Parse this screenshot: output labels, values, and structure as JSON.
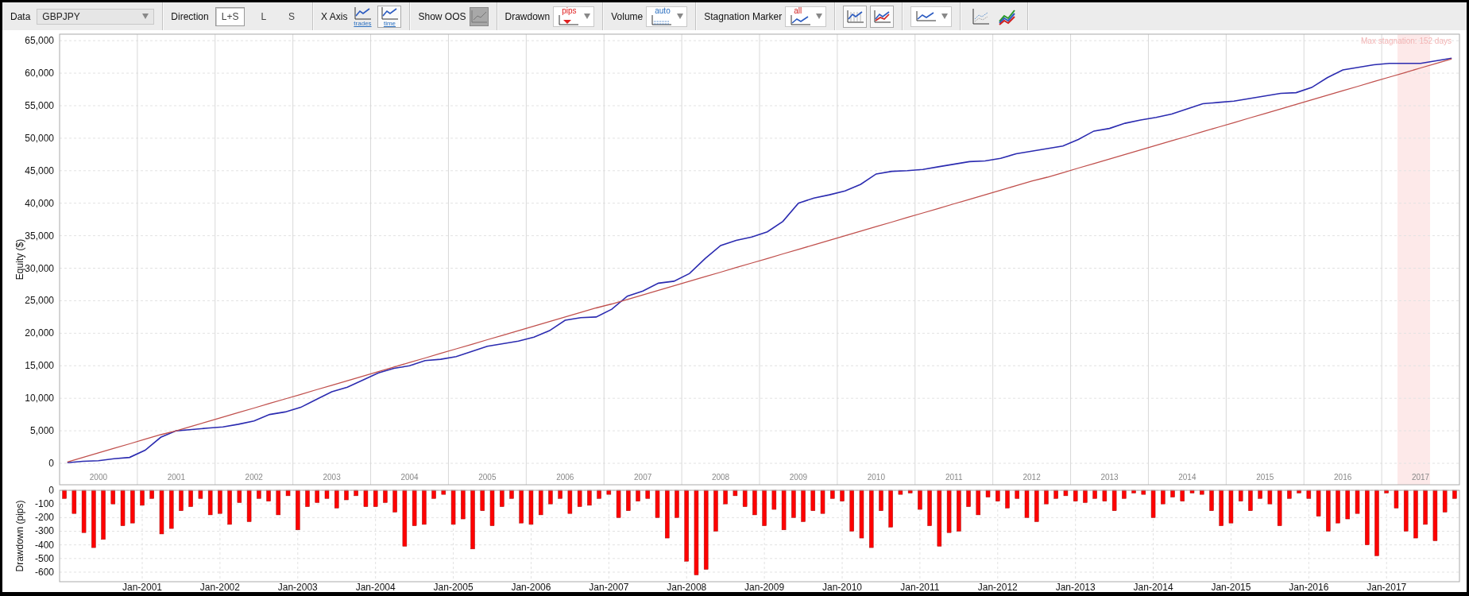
{
  "toolbar": [
    {
      "kind": "dropdown",
      "label": "Data",
      "value": "GBPJPY"
    },
    {
      "kind": "segmented",
      "label": "Direction",
      "options": [
        {
          "text": "L+S",
          "selected": true
        },
        {
          "text": "L",
          "selected": false
        },
        {
          "text": "S",
          "selected": false
        }
      ]
    },
    {
      "kind": "icons",
      "label": "X Axis",
      "buttons": [
        {
          "caption": "trades",
          "selected": false
        },
        {
          "caption": "time",
          "selected": true
        }
      ]
    },
    {
      "kind": "toggle",
      "label": "Show OOS",
      "disabled": true
    },
    {
      "kind": "icon-dropdown",
      "label": "Drawdown",
      "caption": "pips"
    },
    {
      "kind": "icon-dropdown",
      "label": "Volume",
      "caption": "auto"
    },
    {
      "kind": "icon-dropdown",
      "label": "Stagnation Marker",
      "caption": "all"
    },
    {
      "kind": "icons",
      "buttons": [
        {
          "selected": true
        },
        {
          "selected": true
        }
      ]
    },
    {
      "kind": "icon-dropdown"
    },
    {
      "kind": "icons",
      "buttons": [
        {
          "selected": false
        },
        {
          "selected": false
        }
      ]
    }
  ],
  "equity_chart": {
    "chart_data": {
      "type": "line",
      "ylabel": "Equity ($)",
      "categories": [
        null,
        null,
        "2000",
        null,
        null,
        null,
        null,
        "2001",
        null,
        null,
        null,
        null,
        "2002",
        null,
        null,
        null,
        null,
        "2003",
        null,
        null,
        null,
        null,
        "2004",
        null,
        null,
        null,
        null,
        "2005",
        null,
        null,
        null,
        null,
        "2006",
        null,
        null,
        null,
        null,
        "2007",
        null,
        null,
        null,
        null,
        "2008",
        null,
        null,
        null,
        null,
        "2009",
        null,
        null,
        null,
        null,
        "2010",
        null,
        null,
        null,
        null,
        "2011",
        null,
        null,
        null,
        null,
        "2012",
        null,
        null,
        null,
        null,
        "2013",
        null,
        null,
        null,
        null,
        "2014",
        null,
        null,
        null,
        null,
        "2015",
        null,
        null,
        null,
        null,
        "2016",
        null,
        null,
        null,
        null,
        "2017",
        null,
        null
      ],
      "series": [
        {
          "color": "#2b2bb0",
          "values": [
            100,
            300,
            400,
            700,
            900,
            2000,
            4000,
            5000,
            5200,
            5400,
            5600,
            6000,
            6500,
            7500,
            7900,
            8600,
            9800,
            11000,
            11700,
            12800,
            13900,
            14600,
            15000,
            15800,
            16000,
            16400,
            17200,
            18000,
            18400,
            18800,
            19400,
            20400,
            22000,
            22400,
            22500,
            23700,
            25700,
            26500,
            27700,
            28000,
            29200,
            31500,
            33500,
            34300,
            34800,
            35600,
            37200,
            40000,
            40800,
            41300,
            41900,
            42900,
            44500,
            44900,
            45000,
            45200,
            45600,
            46000,
            46400,
            46500,
            46900,
            47600,
            48000,
            48400,
            48800,
            49800,
            51100,
            51500,
            52300,
            52800,
            53200,
            53700,
            54500,
            55300,
            55500,
            55700,
            56100,
            56500,
            56900,
            57000,
            57800,
            59300,
            60500,
            60900,
            61300,
            61500,
            61500,
            61500,
            61900,
            62300
          ]
        },
        {
          "color": "#c0504d",
          "values": [
            200,
            900,
            1600,
            2300,
            3000,
            3700,
            4400,
            5000,
            5700,
            6400,
            7100,
            7800,
            8500,
            9200,
            9900,
            10600,
            11300,
            12000,
            12700,
            13400,
            14100,
            14800,
            15500,
            16200,
            16900,
            17600,
            18300,
            19000,
            19700,
            20400,
            21100,
            21800,
            22500,
            23200,
            23900,
            24500,
            25200,
            25900,
            26600,
            27300,
            28000,
            28700,
            29400,
            30100,
            30800,
            31500,
            32200,
            32900,
            33600,
            34300,
            35000,
            35700,
            36400,
            37100,
            37800,
            38500,
            39200,
            39900,
            40600,
            41300,
            42000,
            42700,
            43400,
            44000,
            44700,
            45400,
            46100,
            46800,
            47500,
            48200,
            48900,
            49600,
            50300,
            51000,
            51700,
            52400,
            53100,
            53800,
            54500,
            55200,
            55900,
            56600,
            57300,
            58000,
            58700,
            59400,
            60100,
            60800,
            61500,
            62200
          ]
        }
      ],
      "ylim": [
        -3300,
        66000
      ],
      "grid": true,
      "yticks": [
        {
          "value": 0,
          "label": "0"
        },
        {
          "value": 5000,
          "label": "5,000"
        },
        {
          "value": 10000,
          "label": "10,000"
        },
        {
          "value": 15000,
          "label": "15,000"
        },
        {
          "value": 20000,
          "label": "20,000"
        },
        {
          "value": 25000,
          "label": "25,000"
        },
        {
          "value": 30000,
          "label": "30,000"
        },
        {
          "value": 35000,
          "label": "35,000"
        },
        {
          "value": 40000,
          "label": "40,000"
        },
        {
          "value": 45000,
          "label": "45,000"
        },
        {
          "value": 50000,
          "label": "50,000"
        },
        {
          "value": 55000,
          "label": "55,000"
        },
        {
          "value": 60000,
          "label": "60,000"
        },
        {
          "value": 65000,
          "label": "65,000"
        }
      ],
      "annotations": [
        "Max stagnation: 152 days"
      ]
    }
  },
  "drawdown_chart": {
    "chart_data": {
      "type": "bar",
      "ylabel": "Drawdown (pips)",
      "categories": [
        null,
        null,
        null,
        null,
        null,
        null,
        null,
        null,
        "Jan-2001",
        null,
        null,
        null,
        null,
        null,
        null,
        null,
        "Jan-2002",
        null,
        null,
        null,
        null,
        null,
        null,
        null,
        "Jan-2003",
        null,
        null,
        null,
        null,
        null,
        null,
        null,
        "Jan-2004",
        null,
        null,
        null,
        null,
        null,
        null,
        null,
        "Jan-2005",
        null,
        null,
        null,
        null,
        null,
        null,
        null,
        "Jan-2006",
        null,
        null,
        null,
        null,
        null,
        null,
        null,
        "Jan-2007",
        null,
        null,
        null,
        null,
        null,
        null,
        null,
        "Jan-2008",
        null,
        null,
        null,
        null,
        null,
        null,
        null,
        "Jan-2009",
        null,
        null,
        null,
        null,
        null,
        null,
        null,
        "Jan-2010",
        null,
        null,
        null,
        null,
        null,
        null,
        null,
        "Jan-2011",
        null,
        null,
        null,
        null,
        null,
        null,
        null,
        "Jan-2012",
        null,
        null,
        null,
        null,
        null,
        null,
        null,
        "Jan-2013",
        null,
        null,
        null,
        null,
        null,
        null,
        null,
        "Jan-2014",
        null,
        null,
        null,
        null,
        null,
        null,
        null,
        "Jan-2015",
        null,
        null,
        null,
        null,
        null,
        null,
        null,
        "Jan-2016",
        null,
        null,
        null,
        null,
        null,
        null,
        null,
        "Jan-2017",
        null,
        null,
        null,
        null,
        null,
        null,
        null
      ],
      "series": [
        {
          "color": "#ff0000",
          "values": [
            -60,
            -170,
            -310,
            -420,
            -360,
            -100,
            -260,
            -240,
            -110,
            -60,
            -320,
            -280,
            -150,
            -120,
            -60,
            -180,
            -170,
            -250,
            -90,
            -230,
            -60,
            -80,
            -180,
            -40,
            -290,
            -120,
            -90,
            -60,
            -130,
            -70,
            -40,
            -120,
            -120,
            -90,
            -160,
            -410,
            -260,
            -250,
            -60,
            -30,
            -250,
            -210,
            -430,
            -150,
            -260,
            -120,
            -60,
            -240,
            -250,
            -180,
            -100,
            -60,
            -170,
            -120,
            -110,
            -60,
            -30,
            -200,
            -150,
            -80,
            -60,
            -200,
            -350,
            -200,
            -520,
            -620,
            -580,
            -300,
            -100,
            -40,
            -120,
            -180,
            -260,
            -140,
            -290,
            -200,
            -230,
            -150,
            -170,
            -60,
            -80,
            -300,
            -350,
            -420,
            -150,
            -270,
            -30,
            -20,
            -140,
            -260,
            -410,
            -310,
            -300,
            -120,
            -180,
            -50,
            -80,
            -130,
            -60,
            -200,
            -230,
            -100,
            -60,
            -40,
            -80,
            -90,
            -60,
            -80,
            -150,
            -60,
            -20,
            -30,
            -200,
            -100,
            -50,
            -80,
            -20,
            -30,
            -150,
            -260,
            -240,
            -80,
            -150,
            -60,
            -100,
            -260,
            -60,
            -20,
            -60,
            -190,
            -300,
            -240,
            -210,
            -170,
            -400,
            -480,
            -20,
            -130,
            -300,
            -350,
            -250,
            -370,
            -160,
            -60
          ]
        }
      ],
      "ylim": [
        -670,
        0
      ],
      "grid": true,
      "yticks": [
        0,
        -100,
        -200,
        -300,
        -400,
        -500,
        -600
      ]
    }
  }
}
